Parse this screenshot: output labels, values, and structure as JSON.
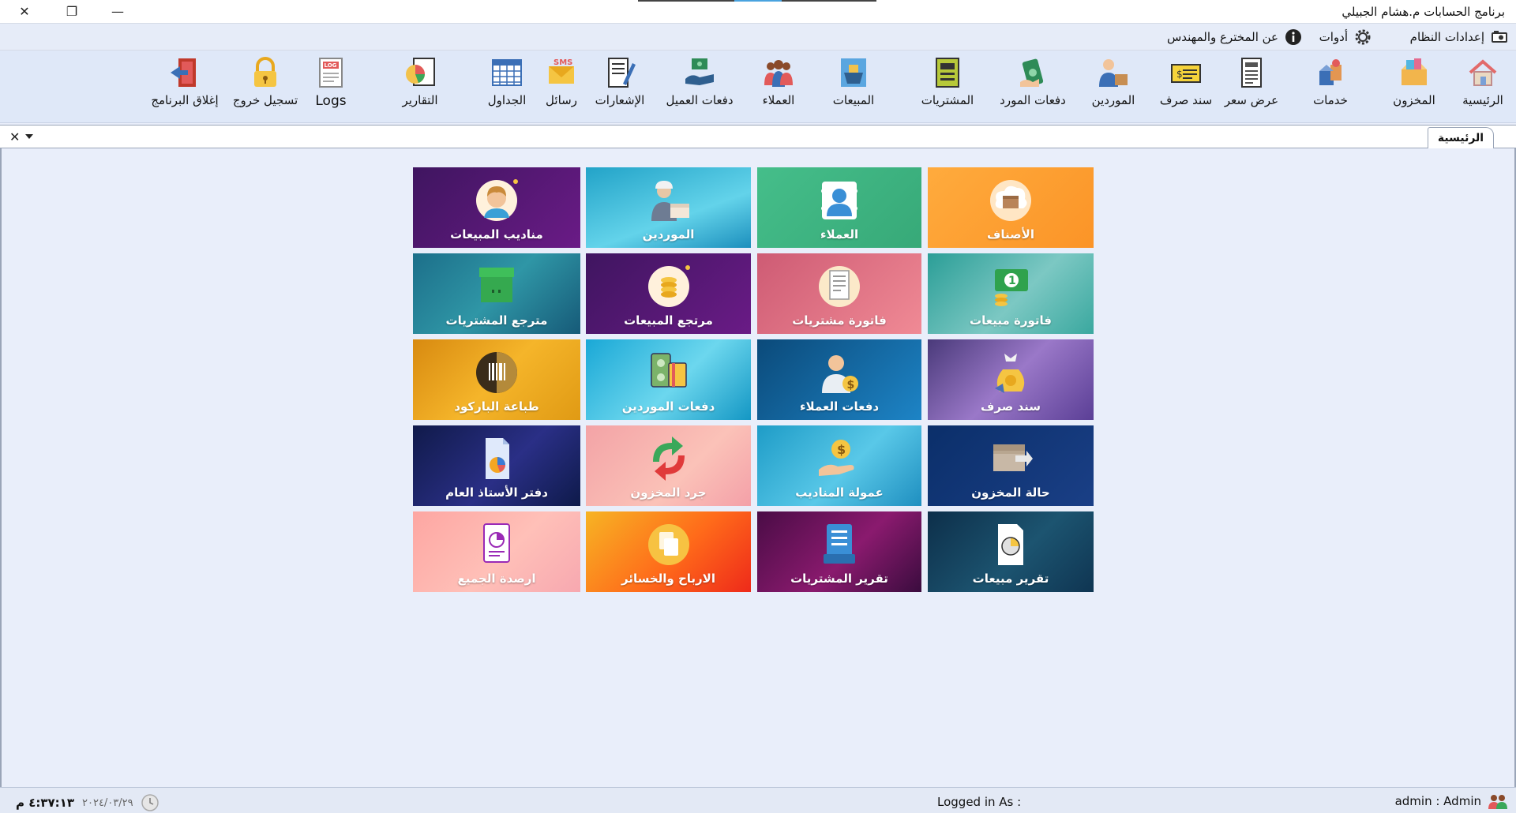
{
  "window": {
    "title": "برنامج الحسابات م.هشام الجبيلي",
    "close_glyph": "✕",
    "restore_glyph": "❐",
    "min_glyph": "—"
  },
  "menu": {
    "system_settings": "إعدادات النظام",
    "tools": "أدوات",
    "about": "عن المخترع والمهندس"
  },
  "toolbar": [
    {
      "label": "الرئيسية",
      "icon": "home-icon"
    },
    {
      "label": "المخزون",
      "icon": "inventory-box-icon"
    },
    {
      "label": "خدمات",
      "icon": "services-icon"
    },
    {
      "label": "عرض سعر",
      "icon": "price-quote-icon"
    },
    {
      "label": "سند صرف",
      "icon": "cash-voucher-icon"
    },
    {
      "label": "الموردين",
      "icon": "supplier-person-icon"
    },
    {
      "label": "دفعات المورد",
      "icon": "supplier-payment-icon"
    },
    {
      "label": "المشتريات",
      "icon": "purchases-icon"
    },
    {
      "label": "المبيعات",
      "icon": "sales-basket-icon"
    },
    {
      "label": "العملاء",
      "icon": "customers-group-icon"
    },
    {
      "label": "دفعات العميل",
      "icon": "customer-payment-icon"
    },
    {
      "label": "الإشعارات",
      "icon": "notifications-icon"
    },
    {
      "label": "رسائل",
      "icon": "sms-icon"
    },
    {
      "label": "الجداول",
      "icon": "tables-icon"
    },
    {
      "label": "التقارير",
      "icon": "reports-icon"
    },
    {
      "label": "Logs",
      "icon": "logs-icon"
    },
    {
      "label": "تسجيل خروج",
      "icon": "lock-icon"
    },
    {
      "label": "إغلاق البرنامج",
      "icon": "exit-icon"
    }
  ],
  "tab": {
    "label": "الرئيسية",
    "close_glyph": "✕"
  },
  "tiles": [
    {
      "label": "الأصناف",
      "icon": "items-box-icon"
    },
    {
      "label": "العملاء",
      "icon": "customers-card-icon"
    },
    {
      "label": "الموردين",
      "icon": "supplier-worker-icon"
    },
    {
      "label": "مناديب المبيعات",
      "icon": "sales-rep-icon"
    },
    {
      "label": "فاتورة مبيعات",
      "icon": "sales-invoice-icon"
    },
    {
      "label": "فاتورة مشتريات",
      "icon": "purchase-invoice-icon"
    },
    {
      "label": "مرتجع المبيعات",
      "icon": "sales-return-icon"
    },
    {
      "label": "مترجع المشتريات",
      "icon": "purchase-return-icon"
    },
    {
      "label": "سند صرف",
      "icon": "money-bag-icon"
    },
    {
      "label": "دفعات العملاء",
      "icon": "customer-payments-icon"
    },
    {
      "label": "دفعات الموردين",
      "icon": "supplier-payments-icon"
    },
    {
      "label": "طباعة الباركود",
      "icon": "barcode-icon"
    },
    {
      "label": "حالة المخزون",
      "icon": "stock-status-icon"
    },
    {
      "label": "عمولة المناديب",
      "icon": "commission-icon"
    },
    {
      "label": "جرد المخزون",
      "icon": "stocktake-arrows-icon"
    },
    {
      "label": "دفتر الأستاذ العام",
      "icon": "ledger-icon"
    },
    {
      "label": "تقرير مبيعات",
      "icon": "sales-report-icon"
    },
    {
      "label": "تقرير المشتريات",
      "icon": "purchases-report-icon"
    },
    {
      "label": "الارباح والخسائر",
      "icon": "profit-loss-icon"
    },
    {
      "label": "ارصدة الجميع",
      "icon": "balances-icon"
    }
  ],
  "status": {
    "user": "admin  :  Admin",
    "logged_in_as": "Logged in As :",
    "date": "٢٠٢٤/٠٣/٢٩",
    "time": "٤:٣٧:١٣ م"
  }
}
